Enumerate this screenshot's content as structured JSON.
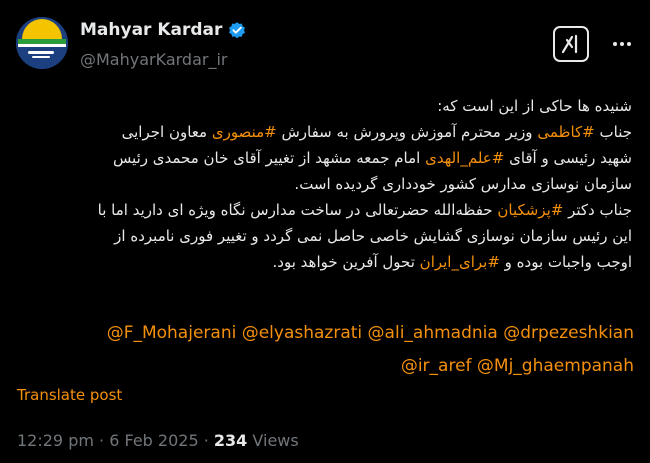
{
  "author": {
    "name": "Mahyar Kardar",
    "handle": "@MahyarKardar_ir",
    "avatar_logo_text": "ماهیار کاردار"
  },
  "colors": {
    "accent": "#f4900c",
    "verified": "#1d9bf0",
    "text": "#e7e9ea",
    "muted": "#71767b",
    "background": "#000000"
  },
  "icons": [
    "verified-badge-icon",
    "grok-icon",
    "more-options-icon"
  ],
  "post": {
    "lines": [
      [
        {
          "t": "شنیده ها حاکی از این است که:"
        }
      ],
      [
        {
          "t": "جناب "
        },
        {
          "t": "#کاظمی",
          "h": true
        },
        {
          "t": " وزیر محترم آموزش وپرورش به سفارش "
        },
        {
          "t": "#منصوری",
          "h": true
        },
        {
          "t": " معاون اجرایی"
        }
      ],
      [
        {
          "t": "شهید رئیسی و آقای "
        },
        {
          "t": "#علم_الهدی",
          "h": true
        },
        {
          "t": " امام جمعه مشهد از تغییر آقای خان محمدی رئیس"
        }
      ],
      [
        {
          "t": "سازمان نوسازی مدارس کشور خودداری گردیده است."
        }
      ],
      [
        {
          "t": "جناب دکتر "
        },
        {
          "t": "#پزشکیان",
          "h": true
        },
        {
          "t": " حفظه‌الله حضرتعالی در ساخت مدارس نگاه ویژه ای دارید اما با"
        }
      ],
      [
        {
          "t": "این رئیس سازمان نوسازی گشایش خاصی حاصل نمی گردد و تغییر فوری نامبرده از"
        }
      ],
      [
        {
          "t": "اوجب واجبات بوده و "
        },
        {
          "t": "#برای_ایران",
          "h": true
        },
        {
          "t": " تحول آفرین خواهد بود."
        }
      ]
    ],
    "mention_lines": [
      "@F_Mohajerani @elyashazrati @ali_ahmadnia @drpezeshkian",
      "@ir_aref @Mj_ghaempanah"
    ]
  },
  "translate_label": "Translate post",
  "meta": {
    "time": "12:29 pm",
    "separator": "·",
    "date": "6 Feb 2025",
    "views_count": "234",
    "views_label": "Views"
  }
}
